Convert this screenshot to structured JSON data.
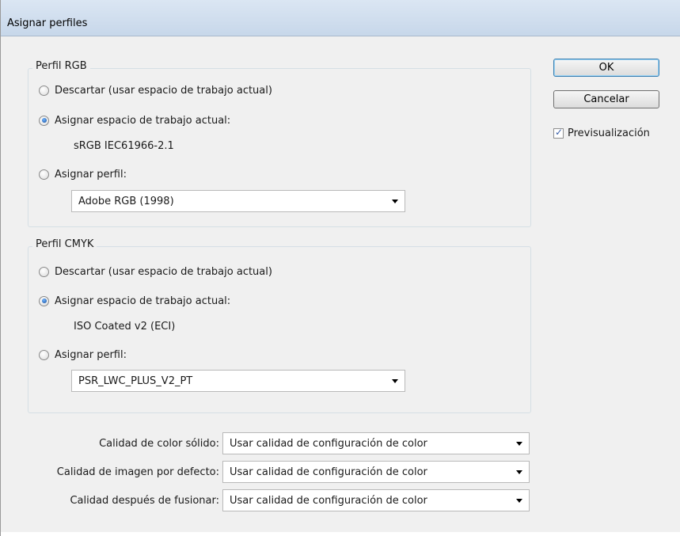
{
  "window": {
    "title": "Asignar perfiles"
  },
  "rgb": {
    "legend": "Perfil RGB",
    "discard_label": "Descartar (usar espacio de trabajo actual)",
    "assign_working_label": "Asignar espacio de trabajo actual:",
    "working_space_value": "sRGB IEC61966-2.1",
    "assign_profile_label": "Asignar perfil:",
    "profile_selected": "Adobe RGB (1998)",
    "selected_option": "assign_working"
  },
  "cmyk": {
    "legend": "Perfil CMYK",
    "discard_label": "Descartar (usar espacio de trabajo actual)",
    "assign_working_label": "Asignar espacio de trabajo actual:",
    "working_space_value": "ISO Coated v2 (ECI)",
    "assign_profile_label": "Asignar perfil:",
    "profile_selected": "PSR_LWC_PLUS_V2_PT",
    "selected_option": "assign_working"
  },
  "quality": {
    "solid_color_label": "Calidad de color sólido:",
    "solid_color_value": "Usar calidad de configuración de color",
    "default_image_label": "Calidad de imagen por defecto:",
    "default_image_value": "Usar calidad de configuración de color",
    "after_blend_label": "Calidad después de fusionar:",
    "after_blend_value": "Usar calidad de configuración de color"
  },
  "buttons": {
    "ok_label": "OK",
    "cancel_label": "Cancelar"
  },
  "preview": {
    "label": "Previsualización",
    "checked": true
  },
  "colors": {
    "titlebar": "#c7d7ea",
    "dialog_bg": "#f0f0f0",
    "default_button_border": "#3c7fb1"
  }
}
